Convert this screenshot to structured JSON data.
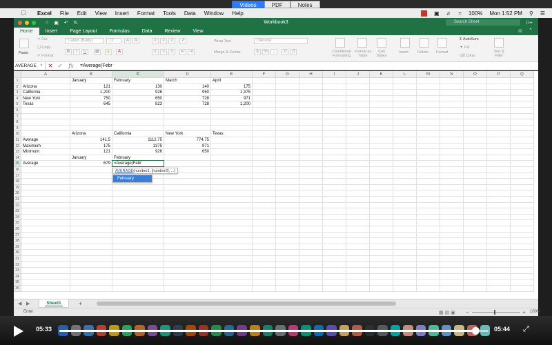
{
  "video_tabs": [
    {
      "label": "Videos",
      "active": true
    },
    {
      "label": "PDF",
      "active": false
    },
    {
      "label": "Notes",
      "active": false
    }
  ],
  "mac_menu": {
    "app": "Excel",
    "items": [
      "File",
      "Edit",
      "View",
      "Insert",
      "Format",
      "Tools",
      "Data",
      "Window",
      "Help"
    ],
    "battery": "100%",
    "clock": "Mon 1:52 PM"
  },
  "window": {
    "title": "Workbook3",
    "search_placeholder": "Search Sheet"
  },
  "ribbon_tabs": [
    "Home",
    "Insert",
    "Page Layout",
    "Formulas",
    "Data",
    "Review",
    "View"
  ],
  "ribbon": {
    "paste": "Paste",
    "cut": "Cut",
    "copy": "Copy",
    "format": "Format",
    "font": "Calibri (Body)",
    "font_size": "12",
    "bold": "B",
    "italic": "I",
    "underline": "U",
    "wrap_text": "Wrap Text",
    "merge_center": "Merge & Center",
    "number_format": "General",
    "conditional_formatting": "Conditional Formatting",
    "format_as_table": "Format as Table",
    "cell_styles": "Cell Styles",
    "insert": "Insert",
    "delete": "Delete",
    "format_cells": "Format",
    "autosum": "AutoSum",
    "fill": "Fill",
    "clear": "Clear",
    "sort_filter": "Sort & Filter"
  },
  "formula_bar": {
    "name_box": "AVERAGE",
    "fx": "fx",
    "content": "=Average(Febr"
  },
  "grid": {
    "columns": [
      "A",
      "B",
      "C",
      "D",
      "E",
      "F",
      "G",
      "H",
      "I",
      "J",
      "K",
      "L",
      "M",
      "N",
      "O",
      "P",
      "Q"
    ],
    "selected_column": "C",
    "row_count": 36,
    "selected_row": 15,
    "cells": [
      {
        "ref": "B1",
        "value": "January",
        "num": false
      },
      {
        "ref": "C1",
        "value": "February",
        "num": false
      },
      {
        "ref": "D1",
        "value": "March",
        "num": false
      },
      {
        "ref": "E1",
        "value": "April",
        "num": false
      },
      {
        "ref": "A2",
        "value": "Arizona",
        "num": false
      },
      {
        "ref": "B2",
        "value": "121",
        "num": true
      },
      {
        "ref": "C2",
        "value": "130",
        "num": true
      },
      {
        "ref": "D2",
        "value": "140",
        "num": true
      },
      {
        "ref": "E2",
        "value": "175",
        "num": true
      },
      {
        "ref": "A3",
        "value": "California",
        "num": false
      },
      {
        "ref": "B3",
        "value": "1,200",
        "num": true
      },
      {
        "ref": "C3",
        "value": "926",
        "num": true
      },
      {
        "ref": "D3",
        "value": "950",
        "num": true
      },
      {
        "ref": "E3",
        "value": "1,375",
        "num": true
      },
      {
        "ref": "A4",
        "value": "New York",
        "num": false
      },
      {
        "ref": "B4",
        "value": "750",
        "num": true
      },
      {
        "ref": "C4",
        "value": "650",
        "num": true
      },
      {
        "ref": "D4",
        "value": "728",
        "num": true
      },
      {
        "ref": "E4",
        "value": "971",
        "num": true
      },
      {
        "ref": "A5",
        "value": "Texas",
        "num": false
      },
      {
        "ref": "B5",
        "value": "645",
        "num": true
      },
      {
        "ref": "C5",
        "value": "823",
        "num": true
      },
      {
        "ref": "D5",
        "value": "728",
        "num": true
      },
      {
        "ref": "E5",
        "value": "1,200",
        "num": true
      },
      {
        "ref": "B10",
        "value": "Arizona",
        "num": false
      },
      {
        "ref": "C10",
        "value": "California",
        "num": false
      },
      {
        "ref": "D10",
        "value": "New York",
        "num": false
      },
      {
        "ref": "E10",
        "value": "Texas",
        "num": false
      },
      {
        "ref": "A11",
        "value": "Average",
        "num": false
      },
      {
        "ref": "B11",
        "value": "141.5",
        "num": true
      },
      {
        "ref": "C11",
        "value": "1112.75",
        "num": true
      },
      {
        "ref": "D11",
        "value": "774.75",
        "num": true
      },
      {
        "ref": "A12",
        "value": "Maximum",
        "num": false
      },
      {
        "ref": "B12",
        "value": "175",
        "num": true
      },
      {
        "ref": "C12",
        "value": "1375",
        "num": true
      },
      {
        "ref": "D12",
        "value": "971",
        "num": true
      },
      {
        "ref": "A13",
        "value": "Minimum",
        "num": false
      },
      {
        "ref": "B13",
        "value": "121",
        "num": true
      },
      {
        "ref": "C13",
        "value": "926",
        "num": true
      },
      {
        "ref": "D13",
        "value": "650",
        "num": true
      },
      {
        "ref": "B14",
        "value": "January",
        "num": false
      },
      {
        "ref": "C14",
        "value": "February",
        "num": false
      },
      {
        "ref": "A15",
        "value": "Average",
        "num": false
      },
      {
        "ref": "B15",
        "value": "679",
        "num": true
      }
    ],
    "active_cell": {
      "ref": "C15",
      "value": "=Average(Febr"
    },
    "autocomplete": {
      "function_name": "AVERAGE",
      "signature_rest": "(number1, [number2], ...)",
      "suggestion": "February"
    }
  },
  "sheet_tabs": {
    "active": "Sheet1",
    "add": "+"
  },
  "status": {
    "mode": "Enter",
    "zoom": "100%"
  },
  "player": {
    "current_time": "05:33",
    "total_time": "05:44",
    "progress": 0.97
  }
}
